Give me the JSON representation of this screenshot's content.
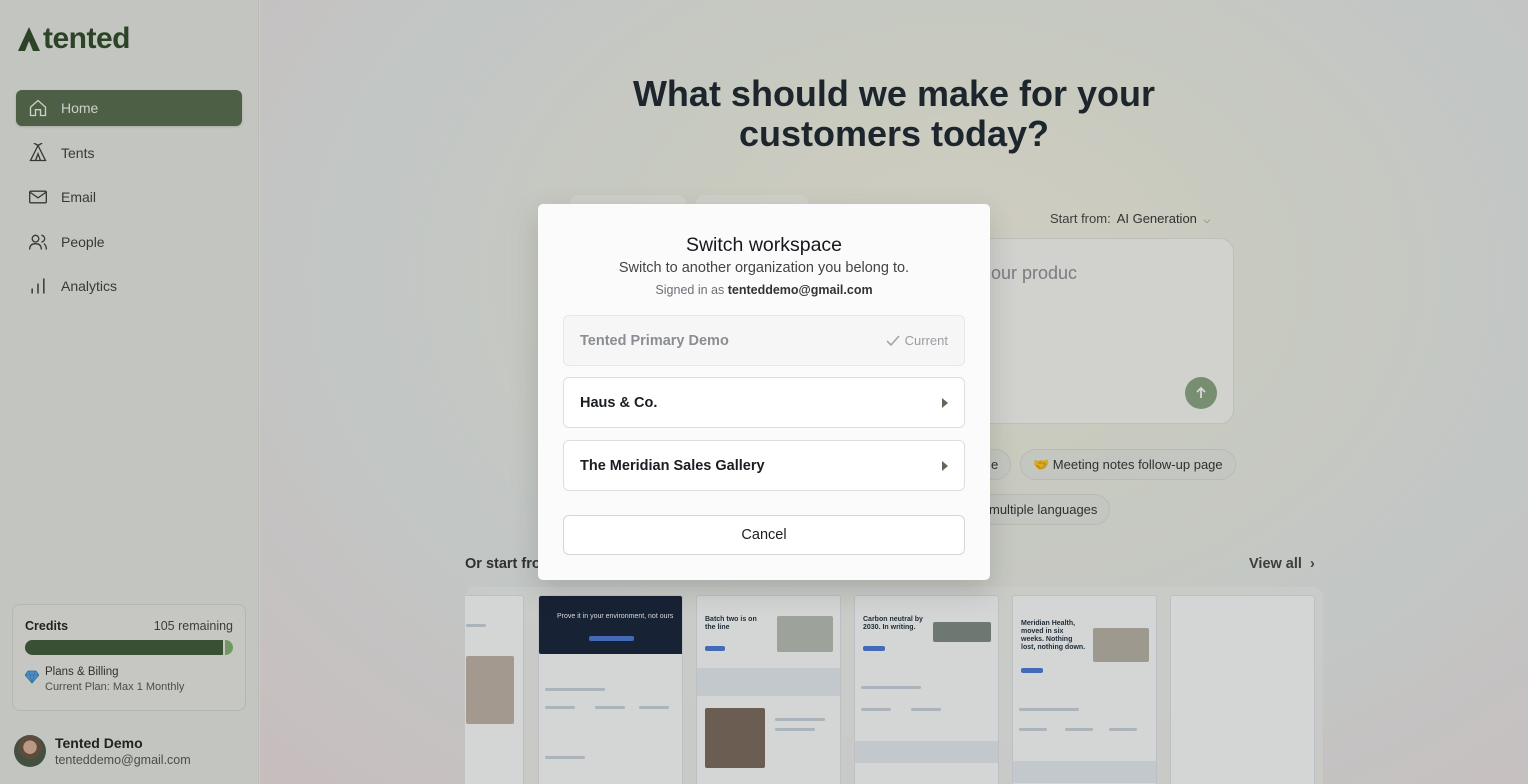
{
  "app": {
    "brand": "tented"
  },
  "sidebar": {
    "items": [
      {
        "label": "Home",
        "icon": "home-icon",
        "active": true
      },
      {
        "label": "Tents",
        "icon": "tent-icon",
        "active": false
      },
      {
        "label": "Email",
        "icon": "mail-icon",
        "active": false
      },
      {
        "label": "People",
        "icon": "people-icon",
        "active": false
      },
      {
        "label": "Analytics",
        "icon": "bar-chart-icon",
        "active": false
      }
    ],
    "credits": {
      "title": "Credits",
      "remaining": "105 remaining",
      "used_fraction": 0.96,
      "billing_title": "Plans & Billing",
      "plan": "Current Plan: Max 1 Monthly"
    },
    "user": {
      "name": "Tented Demo",
      "email": "tenteddemo@gmail.com"
    }
  },
  "main": {
    "hero_line1": "What should we make for your",
    "hero_line2": "customers today?",
    "start_from_label": "Start from:",
    "start_from_value": "AI Generation",
    "prompt_placeholder": "our produc",
    "chips": [
      "e",
      "🤝 Meeting notes follow-up page",
      "multiple languages"
    ],
    "or_start": "Or start fro",
    "view_all": "View all",
    "templates": [
      {
        "headline": "Prove it in your environment, not ours"
      },
      {
        "headline": "Batch two is on the line"
      },
      {
        "headline": "Carbon neutral by 2030. In writing."
      },
      {
        "headline": "Meridian Health, moved in six weeks. Nothing lost, nothing down."
      }
    ]
  },
  "modal": {
    "title": "Switch workspace",
    "subtitle": "Switch to another organization you belong to.",
    "signed_prefix": "Signed in as",
    "signed_email": "tenteddemo@gmail.com",
    "workspaces": [
      {
        "name": "Tented Primary Demo",
        "current": true,
        "current_label": "Current"
      },
      {
        "name": "Haus & Co.",
        "current": false
      },
      {
        "name": "The Meridian Sales Gallery",
        "current": false
      }
    ],
    "cancel_label": "Cancel"
  },
  "colors": {
    "accent": "#566c4e",
    "brand": "#2e4a2a",
    "credit_bar": "#3f5a3a"
  }
}
